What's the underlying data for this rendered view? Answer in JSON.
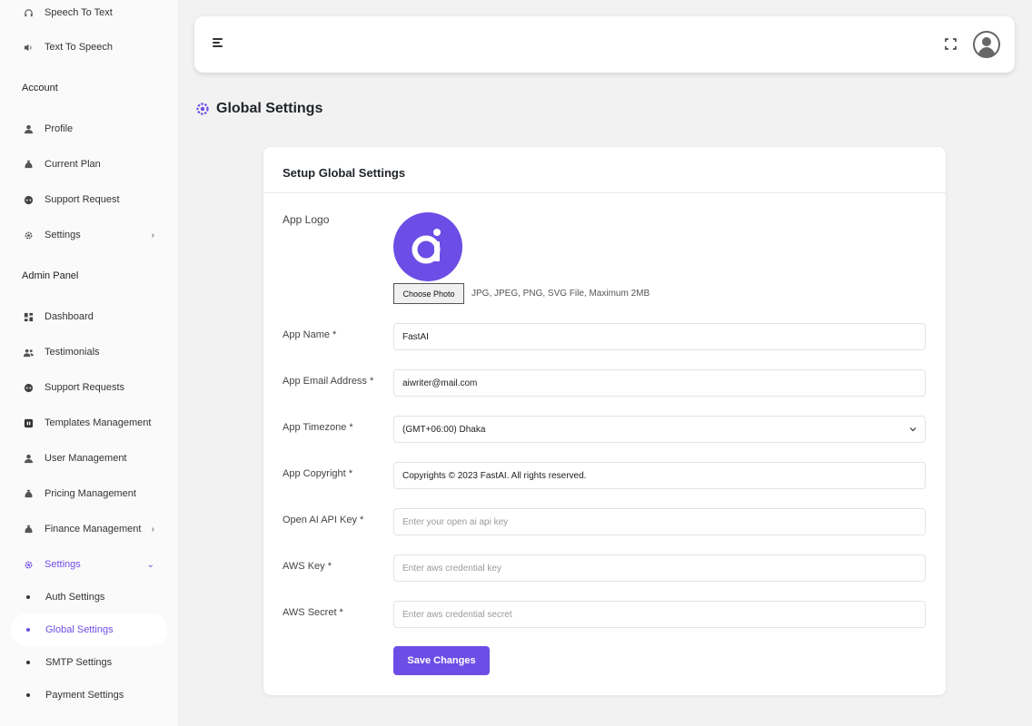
{
  "sidebar": {
    "top_items": [
      {
        "label": "Speech To Text",
        "icon": "headphones-icon"
      },
      {
        "label": "Text To Speech",
        "icon": "speaker-icon"
      }
    ],
    "account_heading": "Account",
    "account_items": [
      {
        "label": "Profile",
        "icon": "user-icon"
      },
      {
        "label": "Current Plan",
        "icon": "money-bag-icon"
      },
      {
        "label": "Support Request",
        "icon": "headset-icon"
      },
      {
        "label": "Settings",
        "icon": "gear-icon"
      }
    ],
    "admin_heading": "Admin Panel",
    "admin_items": [
      {
        "label": "Dashboard",
        "icon": "dashboard-icon"
      },
      {
        "label": "Testimonials",
        "icon": "users-icon"
      },
      {
        "label": "Support Requests",
        "icon": "headset-icon"
      },
      {
        "label": "Templates Management",
        "icon": "template-icon"
      },
      {
        "label": "User Management",
        "icon": "user-icon"
      },
      {
        "label": "Pricing Management",
        "icon": "money-bag-icon"
      },
      {
        "label": "Finance Management",
        "icon": "money-bag-icon"
      },
      {
        "label": "Settings",
        "icon": "gear-icon"
      }
    ],
    "settings_subitems": [
      {
        "label": "Auth Settings"
      },
      {
        "label": "Global Settings"
      },
      {
        "label": "SMTP Settings"
      },
      {
        "label": "Payment Settings"
      }
    ]
  },
  "page": {
    "title": "Global Settings"
  },
  "card": {
    "title": "Setup Global Settings",
    "logo_label": "App Logo",
    "choose_photo_label": "Choose Photo",
    "file_hint": "JPG, JPEG, PNG, SVG File, Maximum 2MB",
    "fields": {
      "app_name": {
        "label": "App Name *",
        "value": "FastAI"
      },
      "app_email": {
        "label": "App Email Address *",
        "value": "aiwriter@mail.com"
      },
      "app_timezone": {
        "label": "App Timezone *",
        "value": "(GMT+06:00) Dhaka"
      },
      "app_copyright": {
        "label": "App Copyright *",
        "value": "Copyrights © 2023 FastAI. All rights reserved."
      },
      "openai_key": {
        "label": "Open AI API Key *",
        "placeholder": "Enter your open ai api key"
      },
      "aws_key": {
        "label": "AWS Key *",
        "placeholder": "Enter aws credential key"
      },
      "aws_secret": {
        "label": "AWS Secret *",
        "placeholder": "Enter aws credential secret"
      }
    },
    "save_label": "Save Changes"
  },
  "colors": {
    "accent": "#6c4de6",
    "background": "#f2f2f2"
  }
}
